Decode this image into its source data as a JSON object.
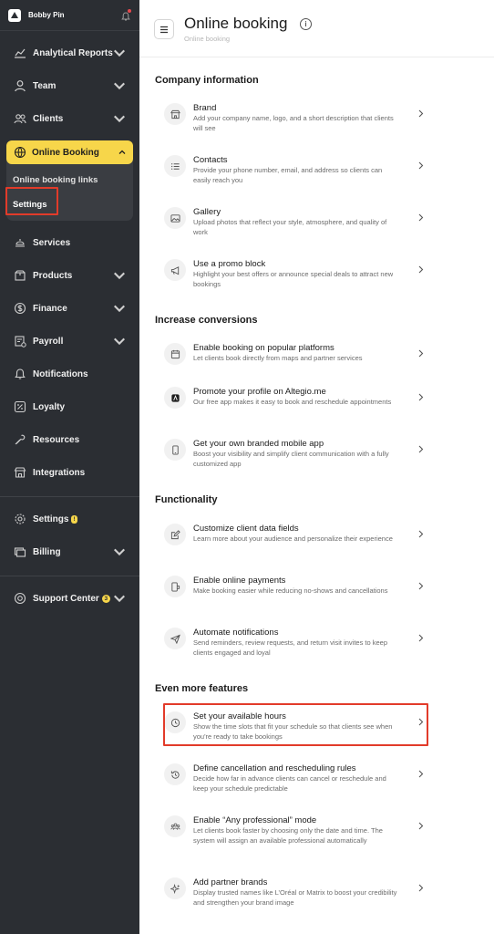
{
  "sidebar": {
    "user_name": "Bobby Pin",
    "items_top": [
      {
        "label": "Analytical Reports",
        "icon": "chart-icon",
        "chevron": true
      },
      {
        "label": "Team",
        "icon": "user-icon",
        "chevron": true
      },
      {
        "label": "Clients",
        "icon": "users-icon",
        "chevron": true
      }
    ],
    "online_booking": {
      "label": "Online Booking",
      "sub_items": [
        "Online booking links",
        "Settings"
      ]
    },
    "items_mid": [
      {
        "label": "Services",
        "icon": "services-icon",
        "chevron": false
      },
      {
        "label": "Products",
        "icon": "box-icon",
        "chevron": true
      },
      {
        "label": "Finance",
        "icon": "dollar-icon",
        "chevron": true
      },
      {
        "label": "Payroll",
        "icon": "payroll-icon",
        "chevron": true
      },
      {
        "label": "Notifications",
        "icon": "bell-icon",
        "chevron": false
      },
      {
        "label": "Loyalty",
        "icon": "percent-icon",
        "chevron": false
      },
      {
        "label": "Resources",
        "icon": "wrench-icon",
        "chevron": false
      },
      {
        "label": "Integrations",
        "icon": "store-icon",
        "chevron": false
      }
    ],
    "settings": {
      "label": "Settings",
      "badge": "!"
    },
    "billing": {
      "label": "Billing"
    },
    "support": {
      "label": "Support Center",
      "badge": "3"
    }
  },
  "header": {
    "title": "Online booking",
    "breadcrumb": "Online booking"
  },
  "sections": [
    {
      "title": "Company information",
      "items": [
        {
          "title": "Brand",
          "desc": "Add your company name, logo, and a short description that clients will see",
          "icon": "storefront-icon"
        },
        {
          "title": "Contacts",
          "desc": "Provide your phone number, email, and address so clients can easily reach you",
          "icon": "list-icon"
        },
        {
          "title": "Gallery",
          "desc": "Upload photos that reflect your style, atmosphere, and quality of work",
          "icon": "image-icon"
        },
        {
          "title": "Use a promo block",
          "desc": "Highlight your best offers or announce special deals to attract new bookings",
          "icon": "megaphone-icon"
        }
      ]
    },
    {
      "title": "Increase conversions",
      "items": [
        {
          "title": "Enable booking on popular platforms",
          "desc": "Let clients book directly from maps and partner services",
          "icon": "calendar-icon"
        },
        {
          "title": "Promote your profile on Altegio.me",
          "desc": "Our free app makes it easy to book and reschedule appointments",
          "icon": "altegio-icon"
        },
        {
          "title": "Get your own branded mobile app",
          "desc": "Boost your visibility and simplify client communication with a fully customized app",
          "icon": "phone-icon"
        }
      ]
    },
    {
      "title": "Functionality",
      "items": [
        {
          "title": "Customize client data fields",
          "desc": "Learn more about your audience and personalize their experience",
          "icon": "edit-icon"
        },
        {
          "title": "Enable online payments",
          "desc": "Make booking easier while reducing no-shows and cancellations",
          "icon": "payment-icon"
        },
        {
          "title": "Automate notifications",
          "desc": "Send reminders, review requests, and return visit invites to keep clients engaged and loyal",
          "icon": "send-icon"
        }
      ]
    },
    {
      "title": "Even more features",
      "items": [
        {
          "title": "Set your available hours",
          "desc": "Show the time slots that fit your schedule so that clients see when you're ready to take bookings",
          "icon": "clock-icon"
        },
        {
          "title": "Define cancellation and rescheduling rules",
          "desc": "Decide how far in advance clients can cancel or reschedule and keep your schedule predictable",
          "icon": "reschedule-icon"
        },
        {
          "title": "Enable “Any professional” mode",
          "desc": "Let clients book faster by choosing only the date and time. The system will assign an available professional automatically",
          "icon": "team-icon"
        },
        {
          "title": "Add partner brands",
          "desc": "Display trusted names like L’Oréal or Matrix to boost your credibility and strengthen your brand image",
          "icon": "sparkle-icon"
        }
      ]
    }
  ],
  "colors": {
    "sidebar_bg": "#2b2e33",
    "accent": "#f7d64a",
    "highlight": "#e23b2a"
  }
}
